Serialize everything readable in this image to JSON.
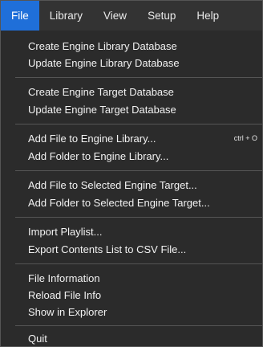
{
  "menubar": {
    "items": [
      "File",
      "Library",
      "View",
      "Setup",
      "Help"
    ],
    "active": "File"
  },
  "file_menu": {
    "groups": [
      [
        {
          "label": "Create Engine Library Database"
        },
        {
          "label": "Update Engine Library Database"
        }
      ],
      [
        {
          "label": "Create Engine Target Database"
        },
        {
          "label": "Update Engine Target Database"
        }
      ],
      [
        {
          "label": "Add File to Engine Library...",
          "shortcut": "ctrl + O"
        },
        {
          "label": "Add Folder to Engine Library..."
        }
      ],
      [
        {
          "label": "Add File to Selected Engine Target..."
        },
        {
          "label": "Add Folder to Selected Engine Target..."
        }
      ],
      [
        {
          "label": "Import Playlist..."
        },
        {
          "label": "Export Contents List to CSV File..."
        }
      ],
      [
        {
          "label": "File Information"
        },
        {
          "label": "Reload File Info"
        },
        {
          "label": "Show in Explorer"
        }
      ],
      [
        {
          "label": "Quit"
        }
      ]
    ]
  },
  "colors": {
    "menu_background": "#2b2b2b",
    "menubar_background": "#333333",
    "active_highlight": "#1f6fd9",
    "separator": "#555555",
    "text": "#f2f2f2"
  }
}
